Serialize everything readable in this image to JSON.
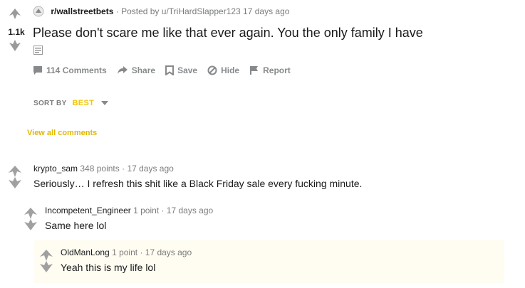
{
  "post": {
    "score": "1.1k",
    "subreddit": "r/wallstreetbets",
    "posted_by": "· Posted by u/TriHardSlapper123 17 days ago",
    "title": "Please don't scare me like that ever again. You the only family I have"
  },
  "actions": {
    "comments": "114 Comments",
    "share": "Share",
    "save": "Save",
    "hide": "Hide",
    "report": "Report"
  },
  "sort": {
    "label": "SORT BY",
    "value": "BEST"
  },
  "view_all": "View all comments",
  "comments": [
    {
      "author": "krypto_sam",
      "points": "348 points",
      "time": "· 17 days ago",
      "body": "Seriously… I refresh this shit like a Black Friday sale every fucking minute."
    },
    {
      "author": "Incompetent_Engineer",
      "points": "1 point",
      "time": "· 17 days ago",
      "body": "Same here lol"
    },
    {
      "author": "OldManLong",
      "points": "1 point",
      "time": "· 17 days ago",
      "body": "Yeah this is my life lol"
    }
  ],
  "colors": {
    "accent_yellow": "#f3c400",
    "muted_text": "#878a8c",
    "text": "#1a1a1b"
  },
  "icons": [
    "upvote-icon",
    "downvote-icon",
    "subreddit-icon",
    "text-post-icon",
    "comment-icon",
    "share-icon",
    "save-icon",
    "hide-icon",
    "report-icon",
    "caret-down-icon"
  ]
}
